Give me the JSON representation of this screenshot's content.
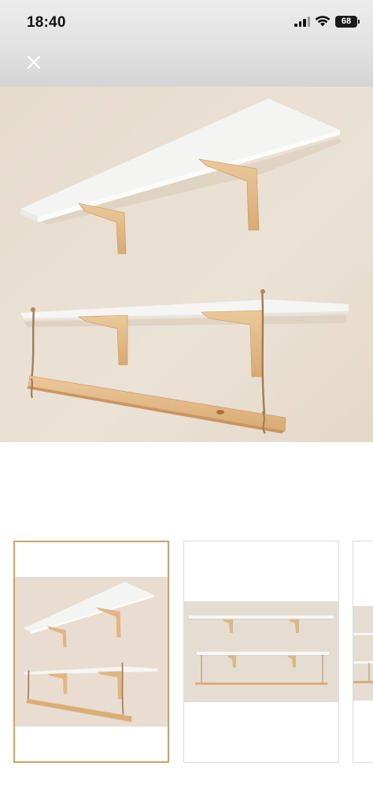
{
  "status_bar": {
    "time": "18:40",
    "battery_level": "68",
    "icons": [
      "cellular-signal-icon",
      "wifi-icon",
      "battery-icon"
    ]
  },
  "viewer": {
    "close_icon": "close-icon",
    "main_image": "product-photo-wall-shelves-with-hanging-rail",
    "thumbnails": [
      {
        "image": "product-photo-wall-shelves-with-hanging-rail",
        "selected": true
      },
      {
        "image": "product-photo-shelves-front-view",
        "selected": false
      },
      {
        "image": "product-photo-partial",
        "selected": false
      }
    ],
    "selected_index": 0
  },
  "colors": {
    "wall": "#e8ddd0",
    "shelf": "#f7f7f6",
    "wood": "#e3bb8b",
    "selected_border": "#d4a063"
  }
}
